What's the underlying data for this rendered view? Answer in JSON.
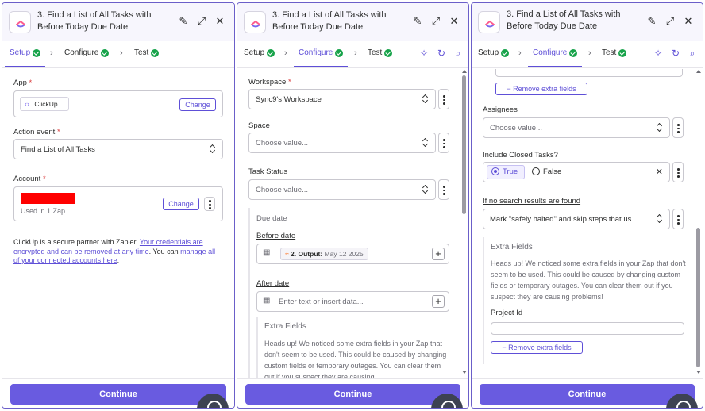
{
  "common": {
    "title_line1": "Find a List of All Tasks with",
    "title_line2": "Before Today Due Date",
    "step_number": "3.",
    "tabs": [
      "Setup",
      "Configure",
      "Test"
    ],
    "continue_label": "Continue",
    "brand_color": "#695be0",
    "success_color": "#17a34a"
  },
  "setup": {
    "app_label": "App",
    "app_value": "ClickUp",
    "change_label": "Change",
    "action_label": "Action event",
    "action_value": "Find a List of All Tasks",
    "account_label": "Account",
    "account_sub": "Used in 1 Zap",
    "account_change_label": "Change",
    "partner_text_1": "ClickUp is a secure partner with Zapier. ",
    "partner_link_1": "Your credentials are encrypted and can be removed at any time",
    "partner_text_2": ". You can ",
    "partner_link_2": "manage all of your connected accounts here",
    "partner_text_3": "."
  },
  "configure_mid": {
    "workspace_label": "Workspace",
    "workspace_value": "Sync9's Workspace",
    "space_label": "Space",
    "space_placeholder": "Choose value...",
    "status_label": "Task Status",
    "status_placeholder": "Choose value...",
    "due_date_label": "Due date",
    "before_date_label": "Before date",
    "before_pill_label": "2. Output:",
    "before_pill_value": "May 12 2025",
    "after_date_label": "After date",
    "after_placeholder": "Enter text or insert data...",
    "extra_fields_title": "Extra Fields",
    "extra_fields_text": "Heads up! We noticed some extra fields in your Zap that don't seem to be used. This could be caused by changing custom fields or temporary outages. You can clear them out if you suspect they are causing"
  },
  "configure_right": {
    "remove_extra_top": "Remove extra fields",
    "assignees_label": "Assignees",
    "assignees_placeholder": "Choose value...",
    "closed_label": "Include Closed Tasks?",
    "radio_true": "True",
    "radio_false": "False",
    "no_results_label": "If no search results are found",
    "no_results_value": "Mark \"safely halted\" and skip steps that us...",
    "extra_fields_title": "Extra Fields",
    "extra_fields_text": "Heads up! We noticed some extra fields in your Zap that don't seem to be used. This could be caused by changing custom fields or temporary outages. You can clear them out if you suspect they are causing problems!",
    "project_id_label": "Project Id",
    "remove_extra_bottom": "Remove extra fields"
  }
}
